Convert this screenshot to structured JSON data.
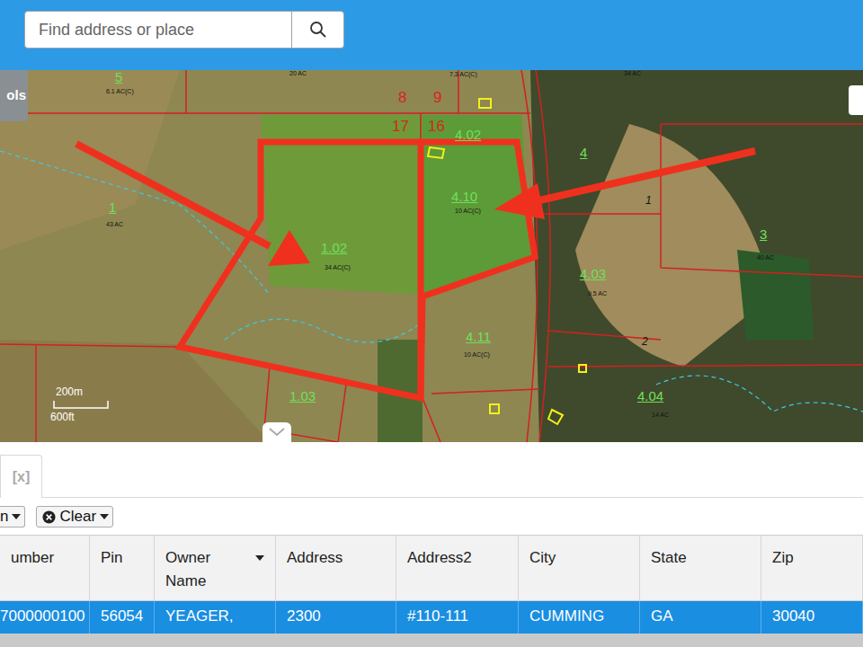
{
  "search": {
    "placeholder": "Find address or place"
  },
  "tools_button": {
    "label": "ols"
  },
  "map": {
    "labels": [
      {
        "text": "5",
        "kind": "parcel"
      },
      {
        "text": "6.1 AC(C)",
        "kind": "acreage"
      },
      {
        "text": "20 AC",
        "kind": "acreage"
      },
      {
        "text": "7.3 AC(C)",
        "kind": "acreage"
      },
      {
        "text": "34 AC",
        "kind": "acreage"
      },
      {
        "text": "8",
        "kind": "lot"
      },
      {
        "text": "9",
        "kind": "lot"
      },
      {
        "text": "17",
        "kind": "lot"
      },
      {
        "text": "16",
        "kind": "lot"
      },
      {
        "text": "4.02",
        "kind": "parcel"
      },
      {
        "text": "4",
        "kind": "parcel"
      },
      {
        "text": "1",
        "kind": "line-number"
      },
      {
        "text": "4.10",
        "kind": "parcel"
      },
      {
        "text": "10 AC(C)",
        "kind": "acreage"
      },
      {
        "text": "1",
        "kind": "parcel"
      },
      {
        "text": "43 AC",
        "kind": "acreage"
      },
      {
        "text": "1.02",
        "kind": "parcel"
      },
      {
        "text": "34 AC(C)",
        "kind": "acreage"
      },
      {
        "text": "3",
        "kind": "parcel"
      },
      {
        "text": "40 AC",
        "kind": "acreage"
      },
      {
        "text": "4.03",
        "kind": "parcel"
      },
      {
        "text": "9.5 AC",
        "kind": "acreage"
      },
      {
        "text": "4.11",
        "kind": "parcel"
      },
      {
        "text": "10 AC(C)",
        "kind": "acreage"
      },
      {
        "text": "2",
        "kind": "line-number"
      },
      {
        "text": "4.04",
        "kind": "parcel"
      },
      {
        "text": "14 AC",
        "kind": "acreage"
      },
      {
        "text": "1.03",
        "kind": "parcel"
      }
    ],
    "scale": {
      "metric": "200m",
      "imperial": "600ft"
    }
  },
  "panel": {
    "tabs": [
      {
        "label": "[x]",
        "selected": true
      }
    ],
    "toolbar": [
      {
        "label": "n",
        "kind": "dropdown"
      },
      {
        "label": "Clear",
        "kind": "clear"
      }
    ]
  },
  "table": {
    "columns": [
      {
        "label": "umber",
        "sortable": false
      },
      {
        "label": "Pin",
        "sortable": false
      },
      {
        "label": "Owner Name",
        "sortable": true
      },
      {
        "label": "Address",
        "sortable": false
      },
      {
        "label": "Address2",
        "sortable": false
      },
      {
        "label": "City",
        "sortable": false
      },
      {
        "label": "State",
        "sortable": false
      },
      {
        "label": "Zip",
        "sortable": false
      }
    ],
    "rows": [
      {
        "cells": [
          "7000000100",
          "56054",
          "YEAGER,",
          "2300",
          "#110-111",
          "CUMMING",
          "GA",
          "30040"
        ],
        "selected": true
      }
    ]
  }
}
